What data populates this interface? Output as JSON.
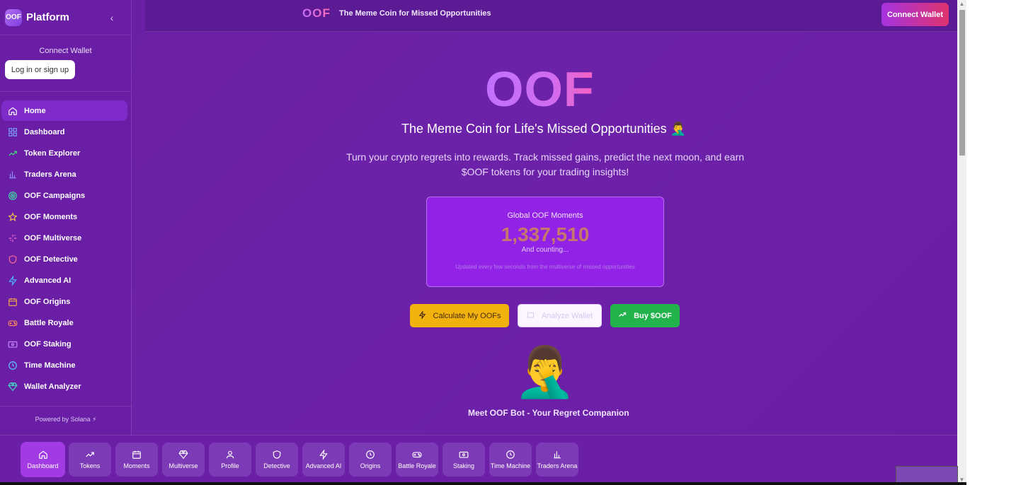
{
  "brand": {
    "logo": "OOF",
    "name": "Platform",
    "collapse": "‹"
  },
  "wallet": {
    "title": "Connect Wallet",
    "login": "Log in or sign up"
  },
  "nav": [
    {
      "label": "Home",
      "icon": "home-icon",
      "color": "#ffffff"
    },
    {
      "label": "Dashboard",
      "icon": "dashboard-icon",
      "color": "#7aa3ff"
    },
    {
      "label": "Token Explorer",
      "icon": "trending-up-icon",
      "color": "#3ee07a"
    },
    {
      "label": "Traders Arena",
      "icon": "bar-chart-icon",
      "color": "#8a8cff"
    },
    {
      "label": "OOF Campaigns",
      "icon": "target-icon",
      "color": "#3ee0a0"
    },
    {
      "label": "OOF Moments",
      "icon": "star-icon",
      "color": "#f5c84a"
    },
    {
      "label": "OOF Multiverse",
      "icon": "sparkles-icon",
      "color": "#ff6bd0"
    },
    {
      "label": "OOF Detective",
      "icon": "shield-icon",
      "color": "#ff6b8a"
    },
    {
      "label": "Advanced AI",
      "icon": "zap-icon",
      "color": "#4ab8ff"
    },
    {
      "label": "OOF Origins",
      "icon": "calendar-icon",
      "color": "#f5a84a"
    },
    {
      "label": "Battle Royale",
      "icon": "gamepad-icon",
      "color": "#ff8a5a"
    },
    {
      "label": "OOF Staking",
      "icon": "wallet-icon",
      "color": "#c68aff"
    },
    {
      "label": "Time Machine",
      "icon": "clock-icon",
      "color": "#5ac8ff"
    },
    {
      "label": "Wallet Analyzer",
      "icon": "gem-icon",
      "color": "#3ee0c0"
    }
  ],
  "powered": "Powered by Solana ⚡",
  "topbar": {
    "logo": "OOF",
    "tagline": "The Meme Coin for Missed Opportunities",
    "connect": "Connect Wallet"
  },
  "hero": {
    "title": "OOF",
    "subtitle": "The Meme Coin for Life's Missed Opportunities",
    "subtitle_emoji": "🤦‍♂️",
    "description": "Turn your crypto regrets into rewards. Track missed gains, predict the next moon, and earn $OOF tokens for your trading insights!"
  },
  "counter": {
    "label": "Global OOF Moments",
    "value": "1,337,510",
    "sub": "And counting...",
    "note": "Updated every few seconds from the multiverse of missed opportunities"
  },
  "actions": {
    "calc": "Calculate My OOFs",
    "analyze": "Analyze Wallet",
    "buy": "Buy $OOF"
  },
  "bot": {
    "emoji": "🤦‍♂️",
    "label": "Meet OOF Bot - Your Regret Companion"
  },
  "bottom_nav": [
    {
      "label": "Dashboard",
      "icon": "home-icon"
    },
    {
      "label": "Tokens",
      "icon": "trending-up-icon"
    },
    {
      "label": "Moments",
      "icon": "calendar-icon"
    },
    {
      "label": "Multiverse",
      "icon": "gem-icon"
    },
    {
      "label": "Profile",
      "icon": "user-icon"
    },
    {
      "label": "Detective",
      "icon": "shield-icon"
    },
    {
      "label": "Advanced AI",
      "icon": "zap-icon"
    },
    {
      "label": "Origins",
      "icon": "clock-icon"
    },
    {
      "label": "Battle Royale",
      "icon": "gamepad-icon"
    },
    {
      "label": "Staking",
      "icon": "wallet-icon"
    },
    {
      "label": "Time Machine",
      "icon": "clock-icon"
    },
    {
      "label": "Traders Arena",
      "icon": "bar-chart-icon"
    }
  ]
}
